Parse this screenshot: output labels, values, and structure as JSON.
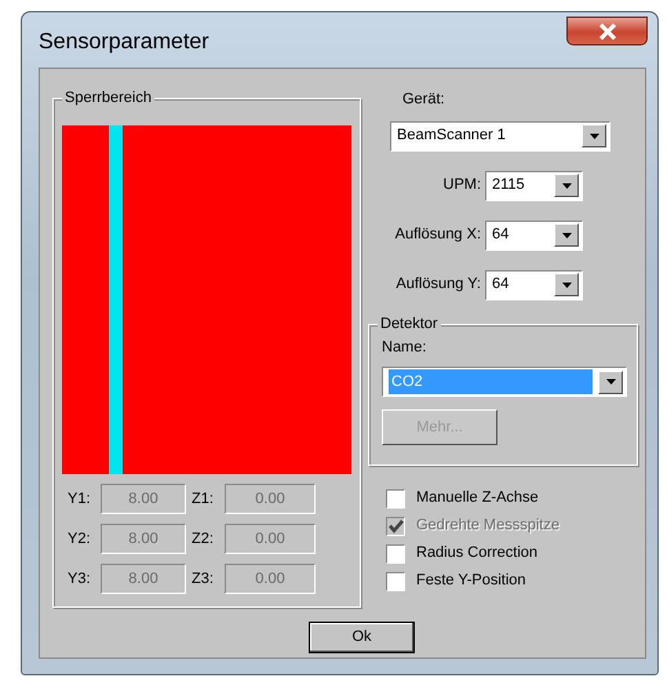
{
  "window": {
    "title": "Sensorparameter"
  },
  "sperrbereich": {
    "title": "Sperrbereich",
    "fields": [
      {
        "label": "Y1:",
        "value": "8.00",
        "disabled": true
      },
      {
        "label": "Z1:",
        "value": "0.00",
        "disabled": true
      },
      {
        "label": "Y2:",
        "value": "8.00",
        "disabled": true
      },
      {
        "label": "Z2:",
        "value": "0.00",
        "disabled": true
      },
      {
        "label": "Y3:",
        "value": "8.00",
        "disabled": true
      },
      {
        "label": "Z3:",
        "value": "0.00",
        "disabled": true
      }
    ]
  },
  "device": {
    "label": "Gerät:",
    "value": "BeamScanner 1"
  },
  "settings": [
    {
      "label": "UPM:",
      "value": "2115"
    },
    {
      "label": "Auflösung X:",
      "value": "64"
    },
    {
      "label": "Auflösung Y:",
      "value": "64"
    }
  ],
  "detector": {
    "title": "Detektor",
    "name_label": "Name:",
    "value": "CO2",
    "selected": true,
    "more_button": {
      "label": "Mehr...",
      "disabled": true
    }
  },
  "options": [
    {
      "label": "Manuelle Z-Achse",
      "checked": false,
      "disabled": false
    },
    {
      "label": "Gedrehte Messspitze",
      "checked": true,
      "disabled": true
    },
    {
      "label": "Radius Correction",
      "checked": false,
      "disabled": false
    },
    {
      "label": "Feste Y-Position",
      "checked": false,
      "disabled": false
    }
  ],
  "ok_button": "Ok"
}
